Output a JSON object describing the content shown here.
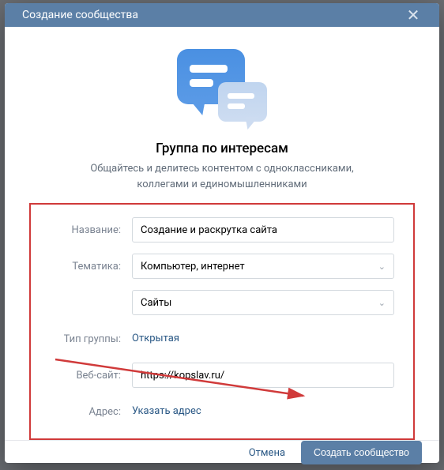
{
  "modal": {
    "title": "Создание сообщества",
    "heading": "Группа по интересам",
    "subheading": "Общайтесь и делитесь контентом с одноклассниками, коллегами и единомышленниками"
  },
  "form": {
    "name_label": "Название:",
    "name_value": "Создание и раскрутка сайта",
    "topic_label": "Тематика:",
    "topic_value": "Компьютер, интернет",
    "subtopic_value": "Сайты",
    "type_label": "Тип группы:",
    "type_value": "Открытая",
    "website_label": "Веб-сайт:",
    "website_value": "https://kopslav.ru/",
    "address_label": "Адрес:",
    "address_value": "Указать адрес"
  },
  "footer": {
    "cancel": "Отмена",
    "submit": "Создать сообщество"
  }
}
